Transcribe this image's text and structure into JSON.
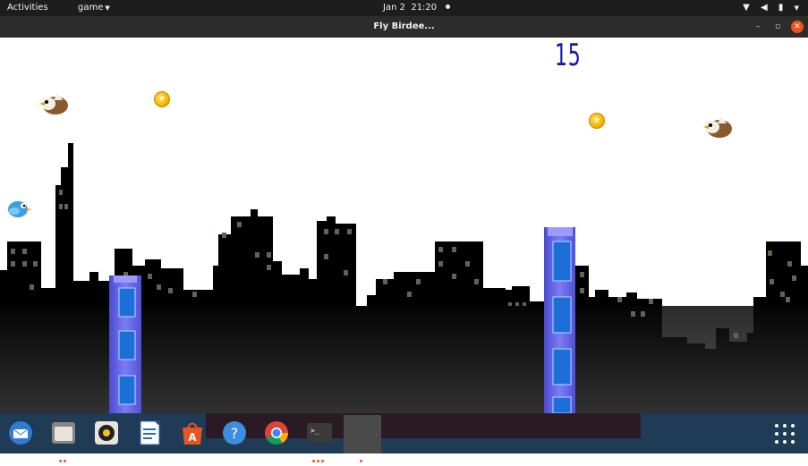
{
  "topbar": {
    "activities": "Activities",
    "app_menu": "game",
    "date": "Jan 2",
    "time": "21:20"
  },
  "window": {
    "title": "Fly Birdee...",
    "minimize": "–",
    "maximize": "▫",
    "close": "✕"
  },
  "game": {
    "score": "15",
    "colors": {
      "score": "#1517a8",
      "pillar": "#6f6ff0",
      "skyline": "#000000",
      "sky": "#ffffff"
    }
  },
  "dock": {
    "apps": [
      "thunderbird-icon",
      "files-icon",
      "rhythmbox-icon",
      "writer-icon",
      "software-icon",
      "help-icon",
      "chrome-icon",
      "terminal-icon",
      "app-window-icon"
    ]
  }
}
